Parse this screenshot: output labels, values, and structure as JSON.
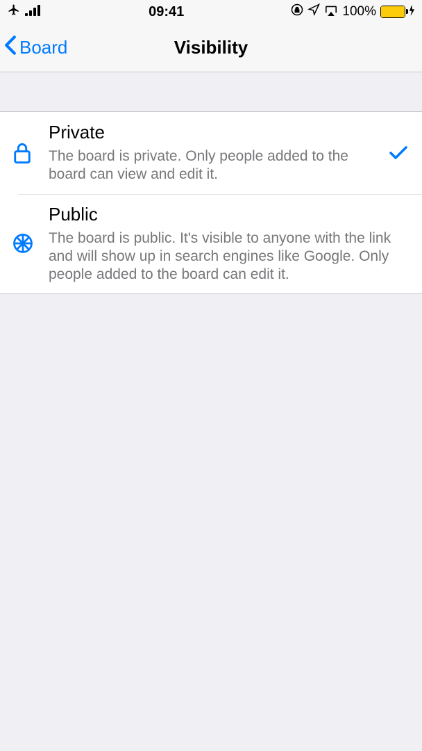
{
  "statusBar": {
    "time": "09:41",
    "batteryPct": "100%"
  },
  "nav": {
    "backLabel": "Board",
    "title": "Visibility"
  },
  "options": {
    "private": {
      "title": "Private",
      "desc": "The board is private. Only people added to the board can view and edit it.",
      "selected": true
    },
    "public": {
      "title": "Public",
      "desc": "The board is public. It's visible to anyone with the link and will show up in search engines like Google. Only people added to the board can edit it.",
      "selected": false
    }
  }
}
